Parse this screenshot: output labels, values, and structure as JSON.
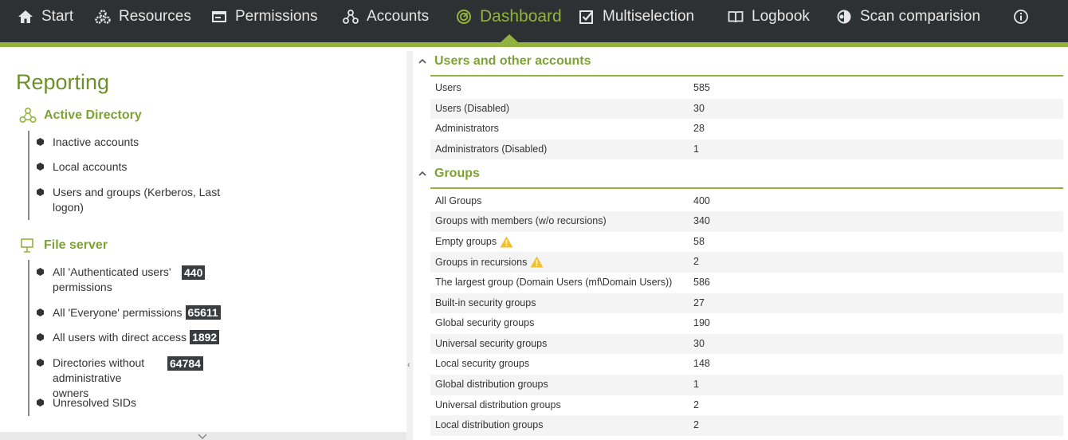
{
  "nav": {
    "items": [
      {
        "label": "Start",
        "icon": "home-icon"
      },
      {
        "label": "Resources",
        "icon": "gears-icon"
      },
      {
        "label": "Permissions",
        "icon": "window-icon"
      },
      {
        "label": "Accounts",
        "icon": "accounts-icon"
      },
      {
        "label": "Dashboard",
        "icon": "dashboard-icon",
        "active": true
      },
      {
        "label": "Multiselection",
        "icon": "checkbox-icon"
      },
      {
        "label": "Logbook",
        "icon": "book-icon"
      },
      {
        "label": "Scan comparision",
        "icon": "compare-icon"
      }
    ],
    "accent": "#93b340",
    "background": "#2e3133"
  },
  "left": {
    "title": "Reporting",
    "active_directory": {
      "heading": "Active Directory",
      "items": [
        {
          "label": "Inactive accounts"
        },
        {
          "label": "Local accounts"
        },
        {
          "label": "Users and groups (Kerberos, Last logon)"
        }
      ]
    },
    "file_server": {
      "heading": "File server",
      "items": [
        {
          "label": "All 'Authenticated users' permissions",
          "badge": "440"
        },
        {
          "label": "All 'Everyone' permissions",
          "badge": "65611"
        },
        {
          "label": "All users with direct access",
          "badge": "1892"
        },
        {
          "label": "Directories without administrative owners",
          "badge": "64784"
        },
        {
          "label": "Unresolved SIDs"
        }
      ]
    }
  },
  "right": {
    "users_section": {
      "title": "Users and other accounts",
      "rows": [
        {
          "label": "Users",
          "value": "585"
        },
        {
          "label": "Users (Disabled)",
          "value": "30"
        },
        {
          "label": "Administrators",
          "value": "28"
        },
        {
          "label": "Administrators (Disabled)",
          "value": "1"
        }
      ]
    },
    "groups_section": {
      "title": "Groups",
      "rows": [
        {
          "label": "All Groups",
          "value": "400"
        },
        {
          "label": "Groups with members (w/o recursions)",
          "value": "340"
        },
        {
          "label": "Empty groups",
          "value": "58",
          "warning": true
        },
        {
          "label": "Groups in recursions",
          "value": "2",
          "warning": true
        },
        {
          "label": "The largest group (Domain Users (mf\\Domain Users))",
          "value": "586"
        },
        {
          "label": "Built-in security groups",
          "value": "27"
        },
        {
          "label": "Global security groups",
          "value": "190"
        },
        {
          "label": "Universal security groups",
          "value": "30"
        },
        {
          "label": "Local security groups",
          "value": "148"
        },
        {
          "label": "Global distribution groups",
          "value": "1"
        },
        {
          "label": "Universal distribution groups",
          "value": "2"
        },
        {
          "label": "Local distribution groups",
          "value": "2"
        }
      ]
    }
  }
}
